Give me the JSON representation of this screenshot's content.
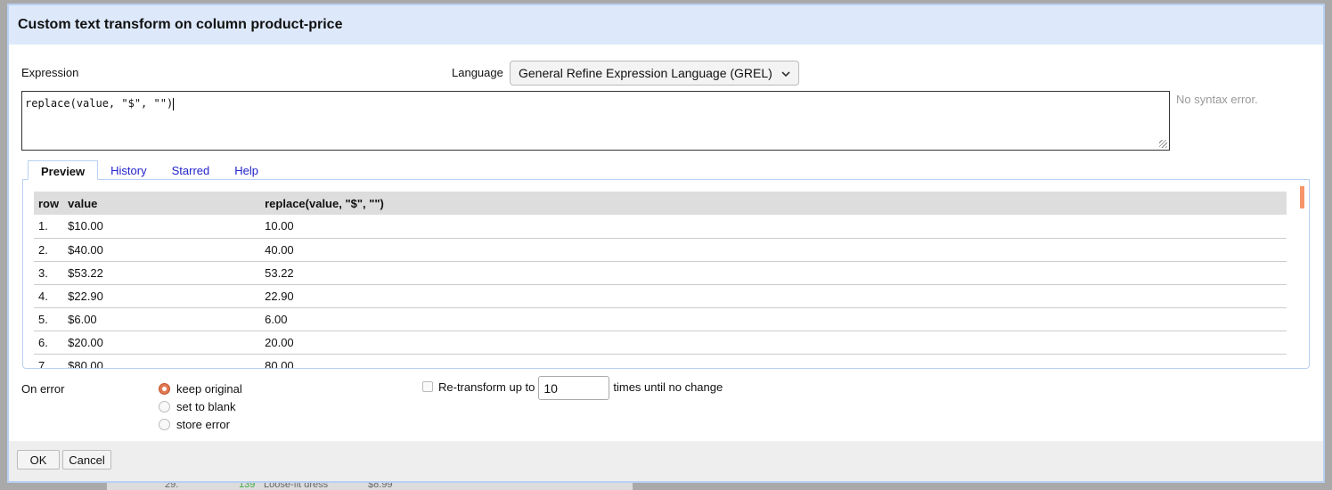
{
  "background": {
    "row_index": "29.",
    "row_count": "139",
    "row_name": "Loose-fit dress",
    "row_price": "$8.99"
  },
  "dialog": {
    "title": "Custom text transform on column product-price"
  },
  "expression": {
    "label": "Expression",
    "value": "replace(value, \"$\", \"\")",
    "status": "No syntax error."
  },
  "language": {
    "label": "Language",
    "selected": "General Refine Expression Language (GREL)"
  },
  "tabs": [
    {
      "label": "Preview",
      "active": true
    },
    {
      "label": "History"
    },
    {
      "label": "Starred"
    },
    {
      "label": "Help"
    }
  ],
  "preview": {
    "headers": [
      "row",
      "value",
      "replace(value, \"$\", \"\")"
    ],
    "rows": [
      [
        "1.",
        "$10.00",
        "10.00"
      ],
      [
        "2.",
        "$40.00",
        "40.00"
      ],
      [
        "3.",
        "$53.22",
        "53.22"
      ],
      [
        "4.",
        "$22.90",
        "22.90"
      ],
      [
        "5.",
        "$6.00",
        "6.00"
      ],
      [
        "6.",
        "$20.00",
        "20.00"
      ],
      [
        "7.",
        "$80.00",
        "80.00"
      ]
    ]
  },
  "on_error": {
    "label": "On error",
    "options": [
      {
        "label": "keep original",
        "selected": true
      },
      {
        "label": "set to blank"
      },
      {
        "label": "store error"
      }
    ]
  },
  "retransform": {
    "label_before": "Re-transform up to",
    "value": "10",
    "label_after": "times until no change",
    "checked": false
  },
  "buttons": {
    "ok": "OK",
    "cancel": "Cancel"
  },
  "colors": {
    "header_bg": "#dde9fb",
    "accent_radio": "#d4643a",
    "link": "#2222cc"
  }
}
